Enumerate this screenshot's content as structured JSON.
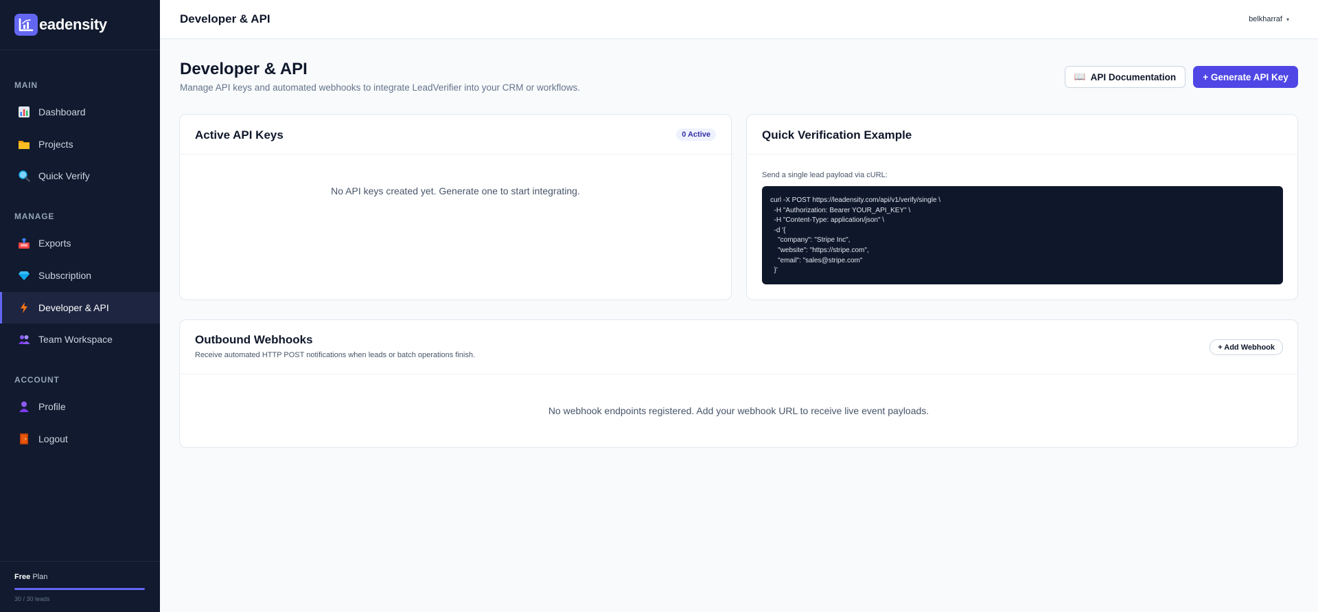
{
  "brand": {
    "name": "eadensity"
  },
  "sidebar": {
    "sections": [
      {
        "label": "MAIN"
      },
      {
        "label": "MANAGE"
      },
      {
        "label": "ACCOUNT"
      }
    ],
    "items": [
      {
        "label": "Dashboard",
        "icon": "bar-chart-icon"
      },
      {
        "label": "Projects",
        "icon": "folder-icon"
      },
      {
        "label": "Quick Verify",
        "icon": "magnifier-icon"
      },
      {
        "label": "Exports",
        "icon": "outbox-tray-icon"
      },
      {
        "label": "Subscription",
        "icon": "gem-icon"
      },
      {
        "label": "Developer & API",
        "icon": "lightning-icon",
        "active": true
      },
      {
        "label": "Team Workspace",
        "icon": "users-icon"
      },
      {
        "label": "Profile",
        "icon": "user-icon"
      },
      {
        "label": "Logout",
        "icon": "door-icon"
      }
    ],
    "plan": {
      "name": "Free",
      "suffix": "Plan",
      "usage": "30 / 30 leads",
      "progress_percent": 100
    }
  },
  "topbar": {
    "title": "Developer & API",
    "username": "belkharraf",
    "caret": "▾"
  },
  "page": {
    "title": "Developer & API",
    "subtitle": "Manage API keys and automated webhooks to integrate LeadVerifier into your CRM or workflows.",
    "doc_button": "API Documentation",
    "doc_icon": "📖",
    "generate_button": "+ Generate API Key"
  },
  "api_keys": {
    "title": "Active API Keys",
    "badge": "0 Active",
    "empty": "No API keys created yet. Generate one to start integrating."
  },
  "quick_verify": {
    "title": "Quick Verification Example",
    "hint": "Send a single lead payload via cURL:",
    "code": "curl -X POST https://leadensity.com/api/v1/verify/single \\\n  -H \"Authorization: Bearer YOUR_API_KEY\" \\\n  -H \"Content-Type: application/json\" \\\n  -d '{\n    \"company\": \"Stripe Inc\",\n    \"website\": \"https://stripe.com\",\n    \"email\": \"sales@stripe.com\"\n  }'"
  },
  "webhooks": {
    "title": "Outbound Webhooks",
    "subtitle": "Receive automated HTTP POST notifications when leads or batch operations finish.",
    "add_button": "+ Add Webhook",
    "empty": "No webhook endpoints registered. Add your webhook URL to receive live event payloads."
  },
  "colors": {
    "accent": "#4f46e5",
    "sidebar_bg": "#111a2e",
    "code_bg": "#0f172a"
  }
}
